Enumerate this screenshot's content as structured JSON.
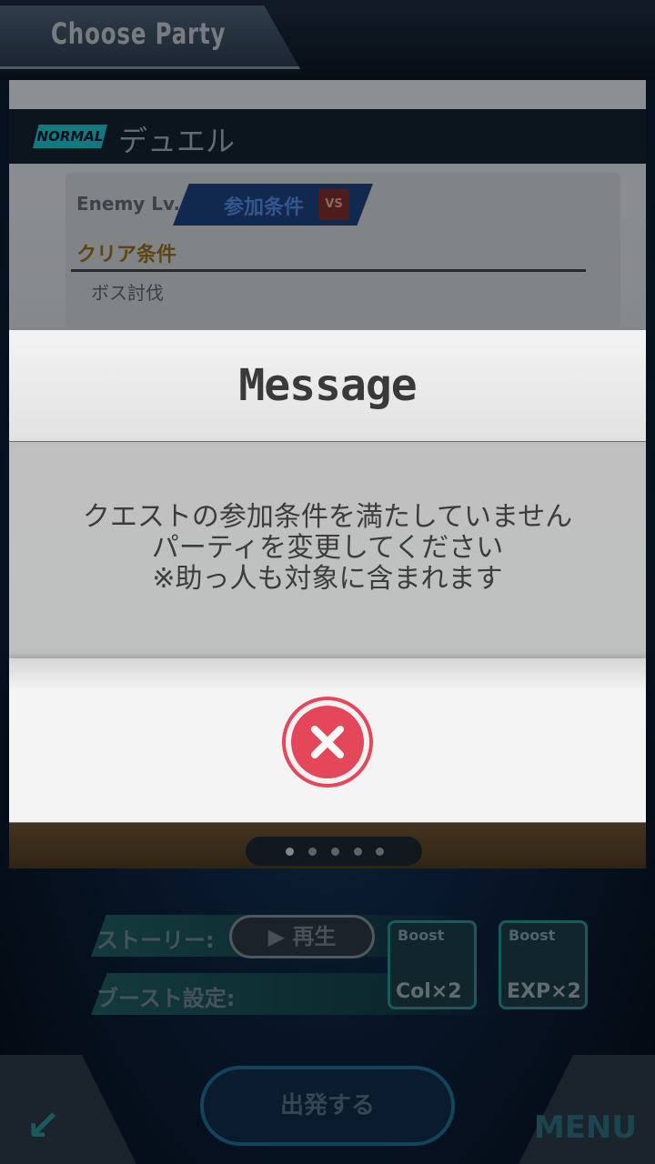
{
  "background": {
    "screen_title": "Choose Party",
    "difficulty_badge": "NORMAL",
    "quest_name": "デュエル",
    "enemy_level": "Enemy Lv. 50",
    "condition_tag": "参加条件",
    "vs_badge": "VS",
    "clear_condition_label": "クリア条件",
    "clear_condition_value": "ボス討伐",
    "story_label": "ストーリー:",
    "play_button": "▶ 再生",
    "boost_label": "ブースト設定:",
    "boosts": [
      {
        "top": "Boost",
        "bottom": "Col×2"
      },
      {
        "top": "Boost",
        "bottom": "EXP×2"
      }
    ],
    "depart_button": "出発する",
    "menu_button": "MENU",
    "back_icon": "back-arrow-icon"
  },
  "modal": {
    "title": "Message",
    "message_lines": [
      "クエストの参加条件を満たしていません",
      "パーティを変更してください",
      "※助っ人も対象に含まれます"
    ],
    "close_icon": "close-icon",
    "accent_color": "#e4465a"
  }
}
